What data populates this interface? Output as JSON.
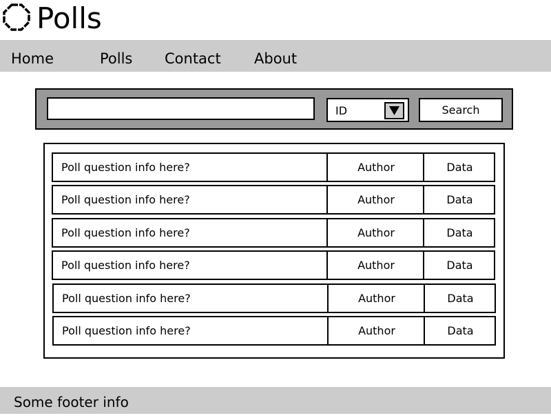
{
  "header": {
    "title": "Polls",
    "logo_icon": "octagon-outline-icon"
  },
  "nav": {
    "items": [
      {
        "label": "Home"
      },
      {
        "label": "Polls"
      },
      {
        "label": "Contact"
      },
      {
        "label": "About"
      }
    ]
  },
  "search": {
    "query": "",
    "filter_value": "ID",
    "button_label": "Search",
    "dropdown_icon": "triangle-down-icon"
  },
  "polls": [
    {
      "question": "Poll question info here?",
      "author": "Author",
      "data": "Data"
    },
    {
      "question": "Poll question info here?",
      "author": "Author",
      "data": "Data"
    },
    {
      "question": "Poll question info here?",
      "author": "Author",
      "data": "Data"
    },
    {
      "question": "Poll question info here?",
      "author": "Author",
      "data": "Data"
    },
    {
      "question": "Poll question info here?",
      "author": "Author",
      "data": "Data"
    },
    {
      "question": "Poll question info here?",
      "author": "Author",
      "data": "Data"
    }
  ],
  "footer": {
    "text": "Some footer info"
  },
  "colors": {
    "nav_bg": "#cccccc",
    "search_panel_bg": "#999999",
    "footer_bg": "#cccccc",
    "border": "#000000"
  }
}
